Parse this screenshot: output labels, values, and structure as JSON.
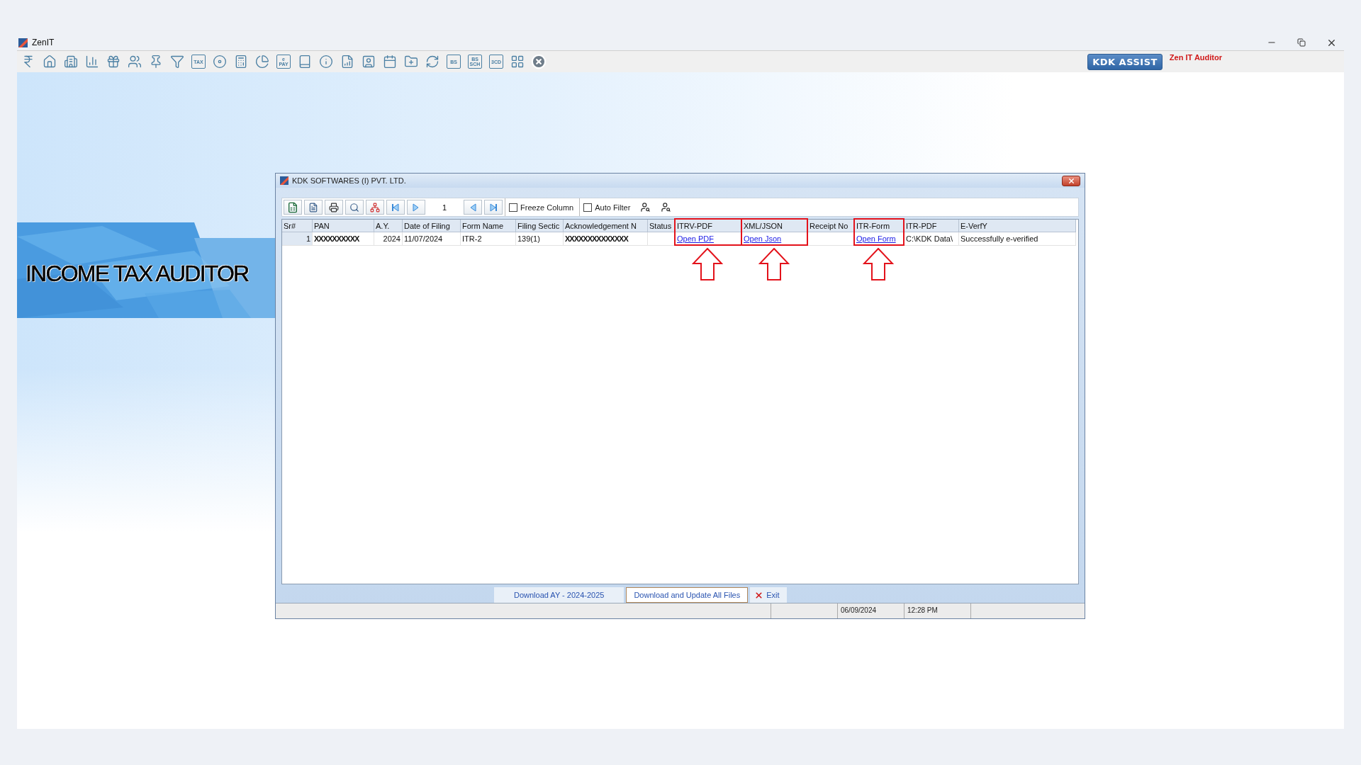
{
  "window": {
    "title": "ZenIT"
  },
  "toolbar": [
    {
      "kind": "rupee"
    },
    {
      "kind": "home"
    },
    {
      "kind": "building"
    },
    {
      "kind": "bar-chart"
    },
    {
      "kind": "gift"
    },
    {
      "kind": "users"
    },
    {
      "kind": "pin"
    },
    {
      "kind": "filter"
    },
    {
      "kind": "text-icon",
      "text": [
        "TAX"
      ]
    },
    {
      "kind": "disc"
    },
    {
      "kind": "calculator"
    },
    {
      "kind": "pie"
    },
    {
      "kind": "text-icon",
      "text": [
        "e",
        "PAY"
      ]
    },
    {
      "kind": "book"
    },
    {
      "kind": "info"
    },
    {
      "kind": "report"
    },
    {
      "kind": "user-card"
    },
    {
      "kind": "calendar"
    },
    {
      "kind": "folder-add"
    },
    {
      "kind": "refresh"
    },
    {
      "kind": "text-icon",
      "text": [
        "BS"
      ]
    },
    {
      "kind": "text-icon",
      "text": [
        "BS",
        "SCH"
      ]
    },
    {
      "kind": "text-icon",
      "text": [
        "3CD"
      ]
    },
    {
      "kind": "grid"
    },
    {
      "kind": "close"
    }
  ],
  "assist_button": "KDK ASSIST",
  "product_name": "Zen IT Auditor",
  "banner": {
    "title": "INCOME TAX AUDITOR"
  },
  "dialog": {
    "title": "KDK SOFTWARES (I) PVT. LTD.",
    "toolbar": {
      "page": "1",
      "options": [
        {
          "label": "Freeze Column",
          "checked": false
        },
        {
          "label": "Auto Filter",
          "checked": false
        }
      ]
    },
    "table": {
      "columns": [
        {
          "label": "Sr#",
          "kind": "number",
          "highlighted": false
        },
        {
          "label": "PAN",
          "kind": "masked",
          "highlighted": false
        },
        {
          "label": "A.Y.",
          "kind": "number",
          "highlighted": false
        },
        {
          "label": "Date of Filing",
          "kind": "text",
          "highlighted": false
        },
        {
          "label": "Form Name",
          "kind": "text",
          "highlighted": false
        },
        {
          "label": "Filing Sectic",
          "kind": "text",
          "highlighted": false
        },
        {
          "label": "Acknowledgement N",
          "kind": "masked",
          "highlighted": false
        },
        {
          "label": "Status",
          "kind": "text",
          "highlighted": false
        },
        {
          "label": "ITRV-PDF",
          "kind": "link",
          "highlighted": true
        },
        {
          "label": "XML/JSON",
          "kind": "link",
          "highlighted": true
        },
        {
          "label": "Receipt No",
          "kind": "text",
          "highlighted": false
        },
        {
          "label": "ITR-Form",
          "kind": "link",
          "highlighted": true
        },
        {
          "label": "ITR-PDF",
          "kind": "text",
          "highlighted": false
        },
        {
          "label": "E-VerfY",
          "kind": "text",
          "highlighted": false
        }
      ],
      "rows": [
        {
          "cells": [
            "1",
            "XXXXXXXXXX",
            "2024",
            "11/07/2024",
            "ITR-2",
            "139(1)",
            "XXXXXXXXXXXXXX",
            null,
            "Open PDF",
            "Open Json",
            null,
            "Open Form",
            "C:\\KDK Data\\",
            "Successfully e-verified"
          ]
        }
      ]
    },
    "actions": [
      {
        "label": "Download AY - 2024-2025",
        "kind": "tab"
      },
      {
        "label": "Download and Update All Files",
        "kind": "button"
      },
      {
        "label": "Exit",
        "kind": "exit"
      }
    ],
    "status_bar": [
      "06/09/2024",
      "12:28 PM"
    ]
  }
}
